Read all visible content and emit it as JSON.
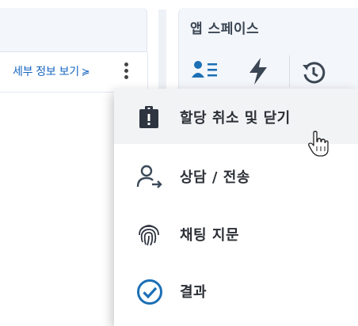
{
  "left_panel": {
    "details_link": "세부 정보 보기"
  },
  "right_panel": {
    "title": "앱 스페이스",
    "icons": [
      "contact-list-icon",
      "lightning-icon",
      "history-icon"
    ]
  },
  "menu": {
    "items": [
      {
        "label": "할당 취소 및 닫기",
        "icon": "clipboard-alert-icon",
        "hovered": true
      },
      {
        "label": "상담 / 전송",
        "icon": "user-transfer-icon",
        "hovered": false
      },
      {
        "label": "채팅 지문",
        "icon": "fingerprint-icon",
        "hovered": false
      },
      {
        "label": "결과",
        "icon": "check-circle-icon",
        "hovered": false
      }
    ]
  },
  "colors": {
    "link": "#1565c0",
    "accent": "#1b6fb5",
    "panel_bg": "#f3f6fb"
  }
}
